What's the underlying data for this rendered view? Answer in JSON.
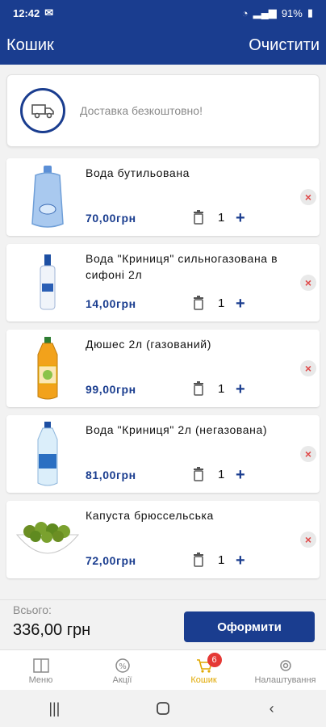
{
  "status": {
    "time": "12:42",
    "battery": "91%"
  },
  "header": {
    "title": "Кошик",
    "clear_label": "Очистити"
  },
  "delivery": {
    "text": "Доставка безкоштовно!"
  },
  "items": [
    {
      "name": "Вода бутильована",
      "price": "70,00грн",
      "qty": "1"
    },
    {
      "name": "Вода \"Криниця\" сильногазована в сифоні 2л",
      "price": "14,00грн",
      "qty": "1"
    },
    {
      "name": "Дюшес 2л (газований)",
      "price": "99,00грн",
      "qty": "1"
    },
    {
      "name": "Вода \"Криниця\" 2л (негазована)",
      "price": "81,00грн",
      "qty": "1"
    },
    {
      "name": "Капуста брюссельська",
      "price": "72,00грн",
      "qty": "1"
    }
  ],
  "totals": {
    "label": "Всього:",
    "sum": "336,00 грн",
    "checkout_label": "Оформити"
  },
  "nav": [
    {
      "label": "Меню"
    },
    {
      "label": "Акції"
    },
    {
      "label": "Кошик",
      "badge": "6"
    },
    {
      "label": "Налаштування"
    }
  ],
  "colors": {
    "primary": "#1a3d8f",
    "active": "#e0a800",
    "danger": "#e04a4a"
  }
}
